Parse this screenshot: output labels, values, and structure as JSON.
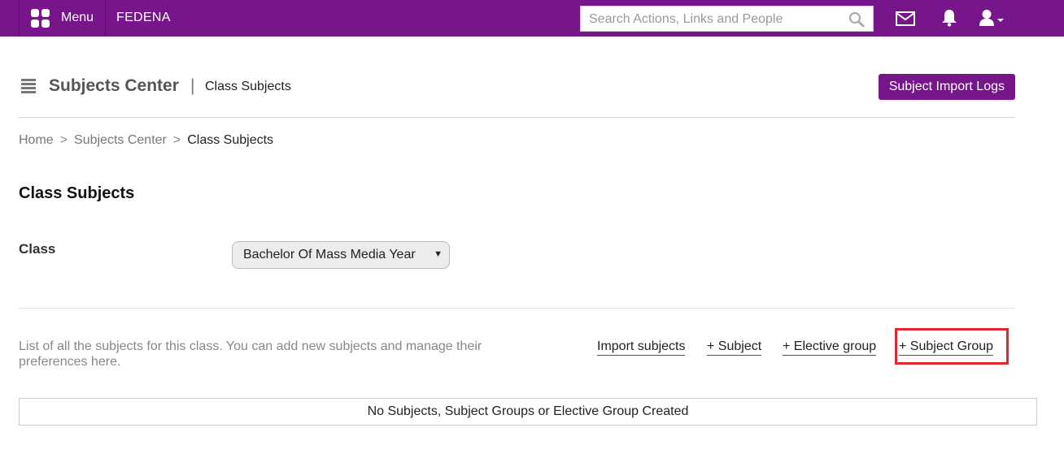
{
  "topbar": {
    "menu_label": "Menu",
    "brand": "FEDENA",
    "search_placeholder": "Search Actions, Links and People",
    "icons": [
      "grid-icon",
      "search-icon",
      "mail-icon",
      "bell-icon",
      "user-icon"
    ]
  },
  "header": {
    "title": "Subjects Center",
    "separator": "|",
    "subtitle": "Class Subjects",
    "import_logs_label": "Subject Import Logs"
  },
  "breadcrumb": {
    "items": [
      "Home",
      "Subjects Center",
      "Class Subjects"
    ],
    "separator": ">"
  },
  "main": {
    "section_title": "Class Subjects",
    "class_label": "Class",
    "class_selected": "Bachelor Of Mass Media Year",
    "description": "List of all the subjects for this class. You can add new subjects and manage their preferences here.",
    "actions": {
      "import": "Import subjects",
      "add_subject": "+ Subject",
      "add_elective": "+ Elective group",
      "add_subject_group": "+ Subject Group"
    },
    "empty_message": "No Subjects, Subject Groups or Elective Group Created"
  },
  "colors": {
    "brand": "#76168a",
    "highlight": "#e0262e"
  }
}
